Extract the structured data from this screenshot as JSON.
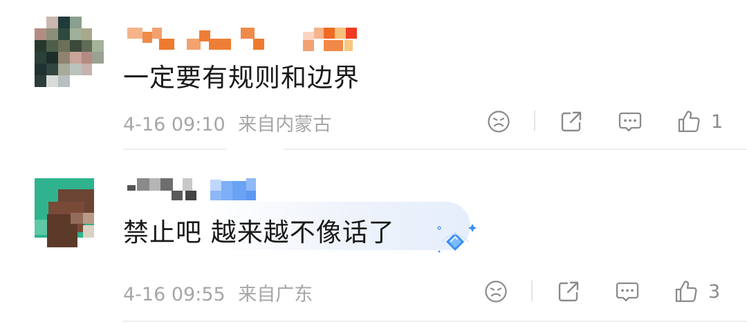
{
  "comments": [
    {
      "content": "一定要有规则和边界",
      "time": "4-16 09:10",
      "location": "来自内蒙古",
      "likes": "1"
    },
    {
      "content": "禁止吧  越来越不像话了",
      "time": "4-16 09:55",
      "location": "来自广东",
      "likes": "3"
    }
  ],
  "icons": {
    "dislike": "frown-face-icon",
    "share": "share-icon",
    "reply": "comment-bubble-icon",
    "like": "thumbs-up-icon",
    "sticker": "blue-diamond-sticker-icon"
  },
  "colors": {
    "meta_text": "#a6a6a6",
    "icon_gray": "#8a8a8a",
    "divider": "#eeeeee"
  }
}
